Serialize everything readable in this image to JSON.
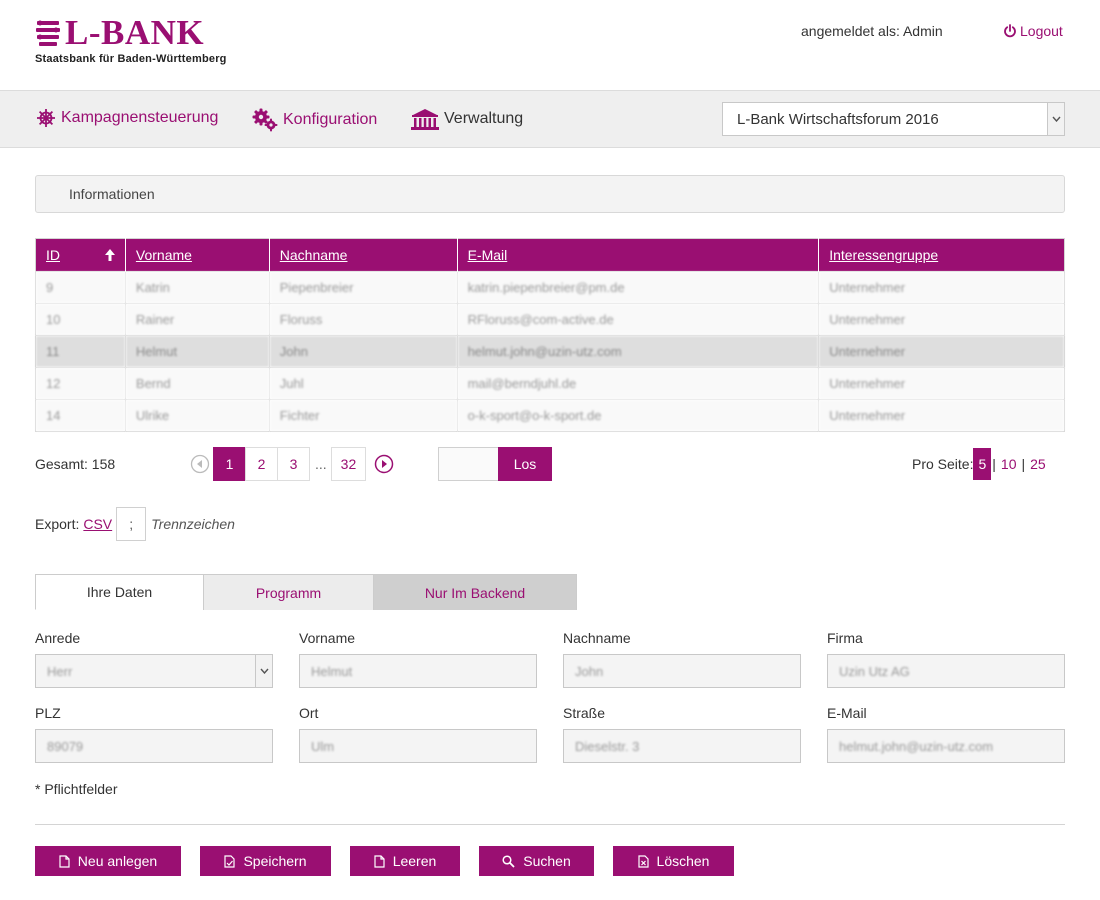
{
  "header": {
    "logo_text": "L-BANK",
    "logo_tagline": "Staatsbank für Baden-Württemberg",
    "user_label": "angemeldet als: Admin",
    "logout_label": "Logout"
  },
  "nav": {
    "items": [
      {
        "label": "Kampagnensteuerung",
        "icon": "ship-wheel-icon"
      },
      {
        "label": "Konfiguration",
        "icon": "gears-icon"
      },
      {
        "label": "Verwaltung",
        "icon": "building-icon"
      }
    ],
    "campaign_select": "L-Bank Wirtschaftsforum 2016"
  },
  "info_bar": {
    "label": "Informationen"
  },
  "table": {
    "columns": [
      "ID",
      "Vorname",
      "Nachname",
      "E-Mail",
      "Interessengruppe"
    ],
    "rows": [
      [
        "9",
        "Katrin",
        "Piepenbreier",
        "katrin.piepenbreier@pm.de",
        "Unternehmer"
      ],
      [
        "10",
        "Rainer",
        "Floruss",
        "RFloruss@com-active.de",
        "Unternehmer"
      ],
      [
        "11",
        "Helmut",
        "John",
        "helmut.john@uzin-utz.com",
        "Unternehmer"
      ],
      [
        "12",
        "Bernd",
        "Juhl",
        "mail@berndjuhl.de",
        "Unternehmer"
      ],
      [
        "14",
        "Ulrike",
        "Fichter",
        "o-k-sport@o-k-sport.de",
        "Unternehmer"
      ]
    ],
    "selected_row": 2
  },
  "pagination": {
    "total_label": "Gesamt: 158",
    "pages": [
      "1",
      "2",
      "3"
    ],
    "ellipsis": "...",
    "last_page": "32",
    "current": "1",
    "goto_label": "Los",
    "per_page_label": "Pro Seite:",
    "per_page_options": [
      "5",
      "10",
      "25"
    ],
    "per_page_current": "5"
  },
  "export": {
    "label": "Export:",
    "csv_label": "CSV",
    "separator": ";",
    "separator_hint": "Trennzeichen"
  },
  "tabs": [
    "Ihre Daten",
    "Programm",
    "Nur Im Backend"
  ],
  "form": {
    "fields": [
      {
        "label": "Anrede",
        "value": "Herr"
      },
      {
        "label": "Vorname",
        "value": "Helmut"
      },
      {
        "label": "Nachname",
        "value": "John"
      },
      {
        "label": "Firma",
        "value": "Uzin Utz AG"
      },
      {
        "label": "PLZ",
        "value": "89079"
      },
      {
        "label": "Ort",
        "value": "Ulm"
      },
      {
        "label": "Straße",
        "value": "Dieselstr. 3"
      },
      {
        "label": "E-Mail",
        "value": "helmut.john@uzin-utz.com"
      }
    ],
    "required_note": "* Pflichtfelder"
  },
  "buttons": {
    "new": "Neu anlegen",
    "save": "Speichern",
    "clear": "Leeren",
    "search": "Suchen",
    "delete": "Löschen"
  },
  "colors": {
    "brand": "#9a0f72"
  }
}
